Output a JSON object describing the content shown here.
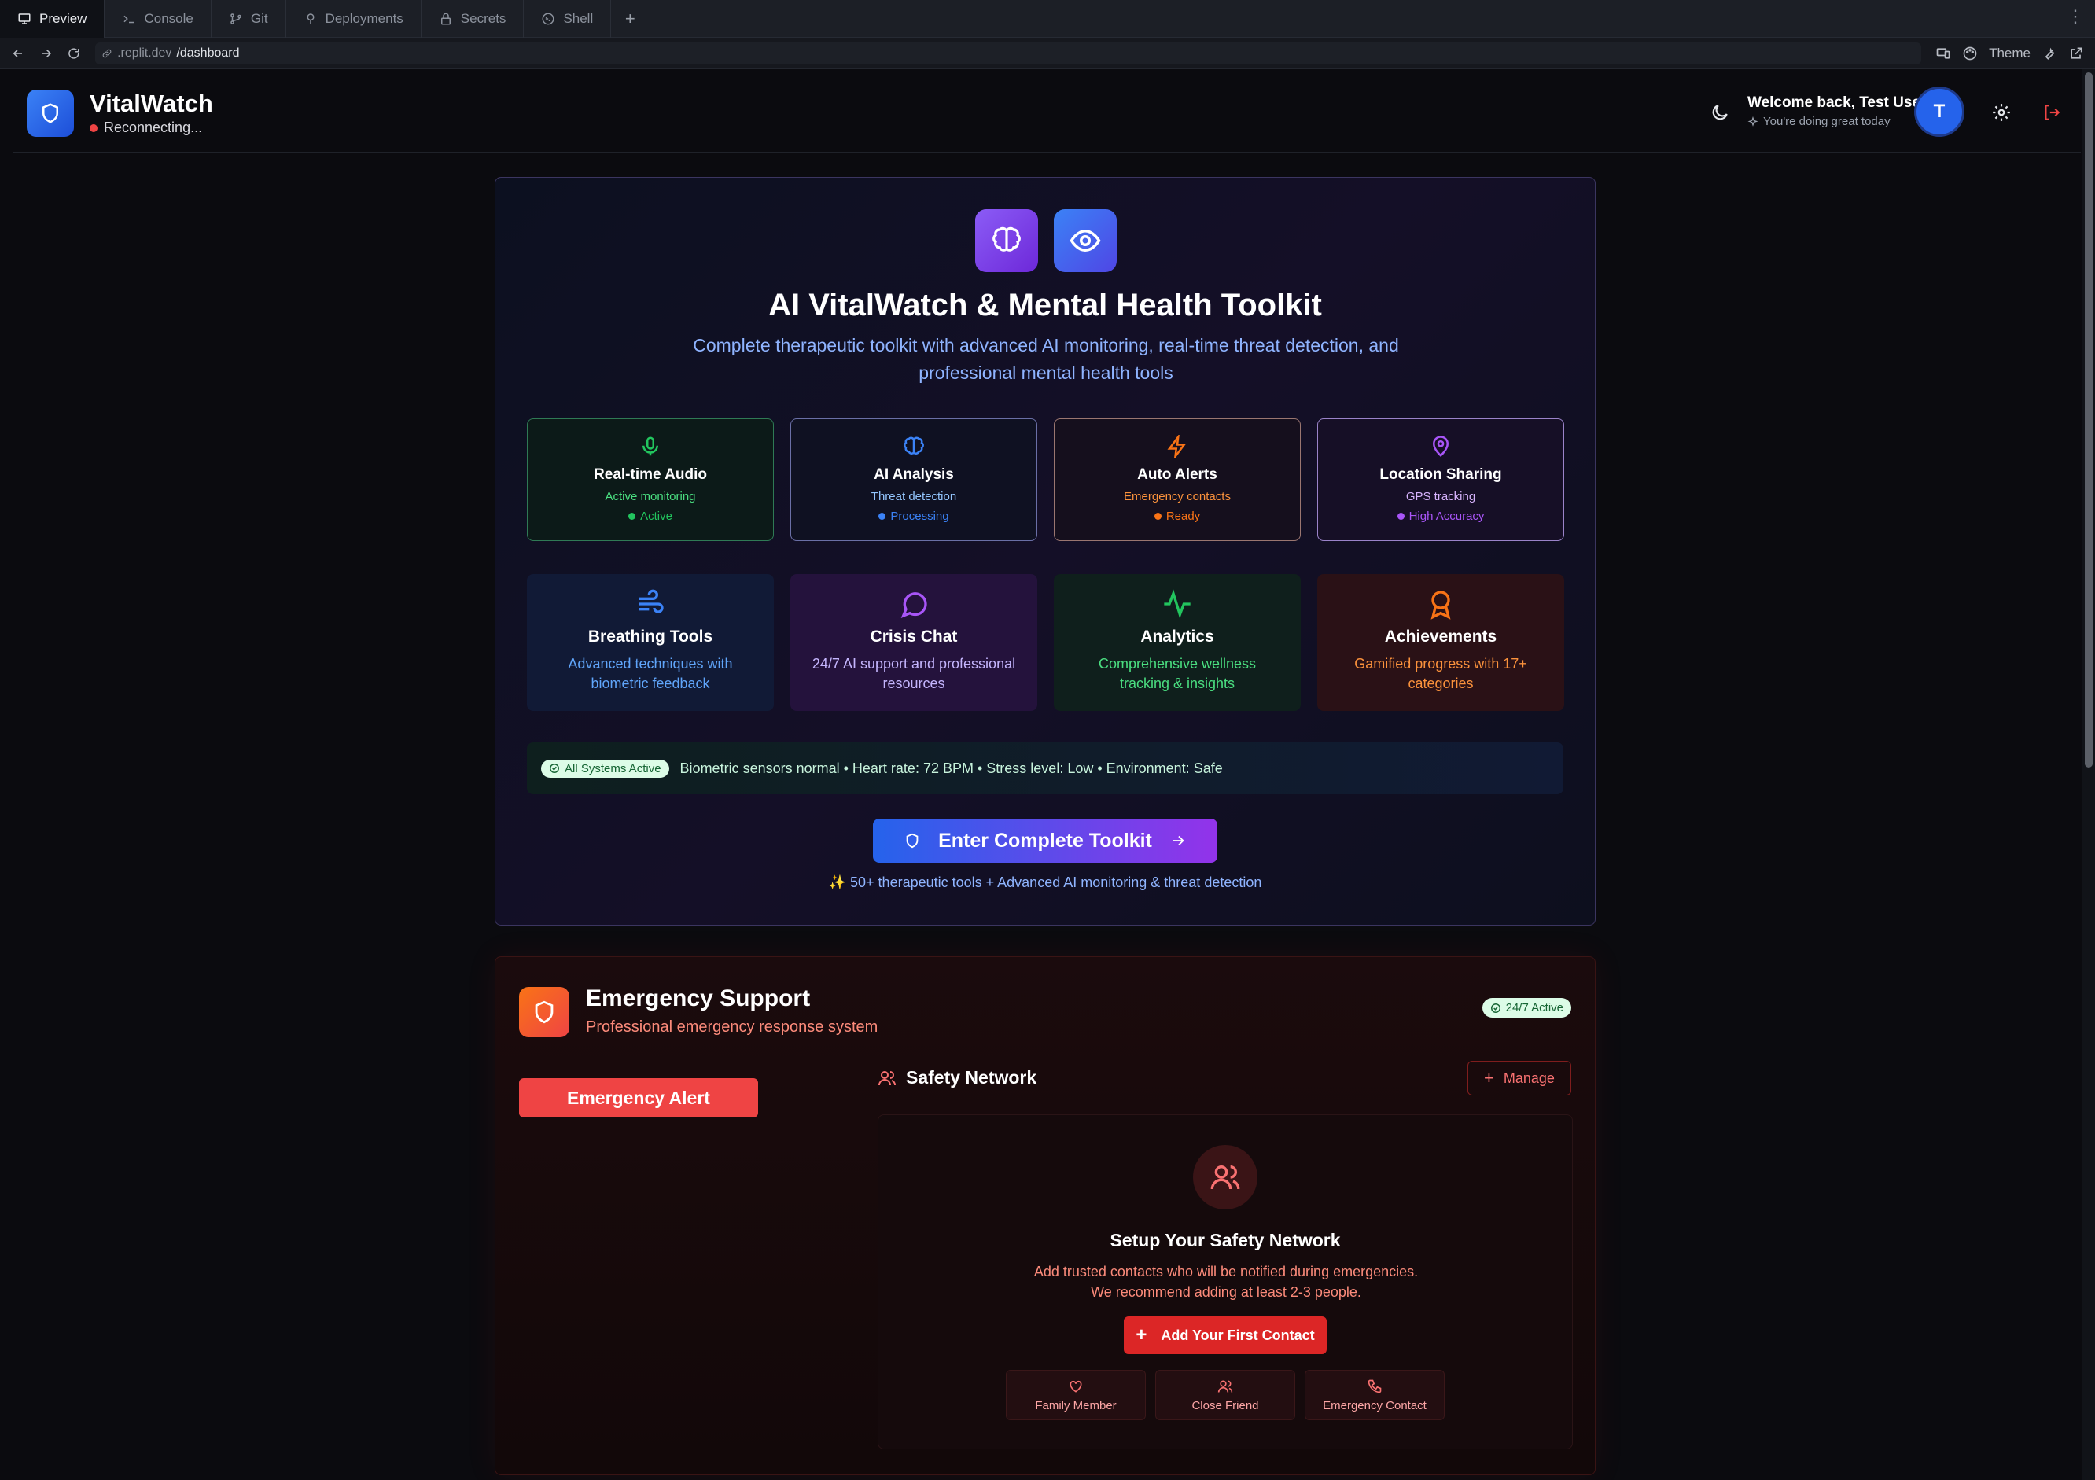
{
  "ide": {
    "tabs": [
      "Preview",
      "Console",
      "Git",
      "Deployments",
      "Secrets",
      "Shell"
    ],
    "add": "+",
    "more": "⋮"
  },
  "browser": {
    "url_host": ".replit.dev",
    "url_path": "/dashboard",
    "theme_label": "Theme"
  },
  "header": {
    "app_name": "VitalWatch",
    "connection_status": "Reconnecting...",
    "welcome": "Welcome back, Test User",
    "welcome_sub": "You're doing great today",
    "avatar_initial": "T"
  },
  "toolkit": {
    "title": "AI VitalWatch & Mental Health Toolkit",
    "subtitle": "Complete therapeutic toolkit with advanced AI monitoring, real-time threat detection, and professional mental health tools",
    "status_cards": [
      {
        "title": "Real-time Audio",
        "desc": "Active monitoring",
        "state": "Active",
        "color": "#22c55e",
        "icon": "mic-icon"
      },
      {
        "title": "AI Analysis",
        "desc": "Threat detection",
        "state": "Processing",
        "color": "#3b82f6",
        "icon": "brain-icon"
      },
      {
        "title": "Auto Alerts",
        "desc": "Emergency contacts",
        "state": "Ready",
        "color": "#f97316",
        "icon": "zap-icon"
      },
      {
        "title": "Location Sharing",
        "desc": "GPS tracking",
        "state": "High Accuracy",
        "color": "#a855f7",
        "icon": "map-pin-icon"
      }
    ],
    "feature_cards": [
      {
        "title": "Breathing Tools",
        "desc": "Advanced techniques with biometric feedback",
        "color": "#60a5fa",
        "icon": "wind-icon"
      },
      {
        "title": "Crisis Chat",
        "desc": "24/7 AI support and professional resources",
        "color": "#c4b5fd",
        "icon": "chat-icon"
      },
      {
        "title": "Analytics",
        "desc": "Comprehensive wellness tracking & insights",
        "color": "#4ade80",
        "icon": "activity-icon"
      },
      {
        "title": "Achievements",
        "desc": "Gamified progress with 17+ categories",
        "color": "#fb923c",
        "icon": "award-icon"
      }
    ],
    "system_badge": "All Systems Active",
    "system_text": "Biometric sensors normal • Heart rate: 72 BPM • Stress level: Low • Environment: Safe",
    "enter_button": "Enter Complete Toolkit",
    "footer": "✨ 50+ therapeutic tools + Advanced AI monitoring & threat detection"
  },
  "emergency": {
    "title": "Emergency Support",
    "subtitle": "Professional emergency response system",
    "badge": "24/7 Active",
    "alert_button": "Emergency Alert",
    "safety_network_title": "Safety Network",
    "manage_button": "Manage",
    "setup_title": "Setup Your Safety Network",
    "setup_desc_1": "Add trusted contacts who will be notified during emergencies.",
    "setup_desc_2": "We recommend adding at least 2-3 people.",
    "add_contact_button": "Add Your First Contact",
    "contact_types": [
      {
        "label": "Family Member",
        "icon": "heart-icon"
      },
      {
        "label": "Close Friend",
        "icon": "users-icon"
      },
      {
        "label": "Emergency Contact",
        "icon": "phone-icon"
      }
    ]
  }
}
